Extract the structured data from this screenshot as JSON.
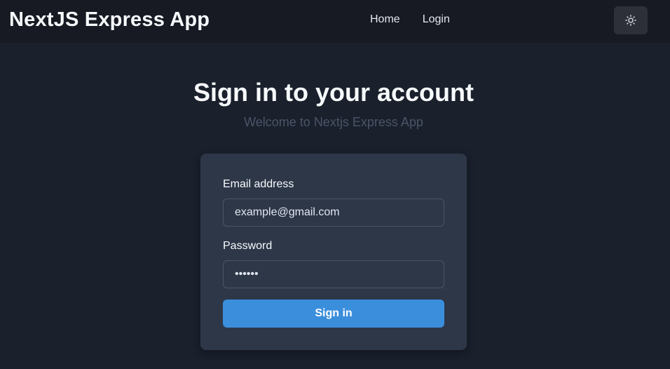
{
  "header": {
    "brand": "NextJS Express App",
    "nav": [
      {
        "label": "Home"
      },
      {
        "label": "Login"
      }
    ],
    "theme_toggle_icon": "sun-icon"
  },
  "main": {
    "title": "Sign in to your account",
    "subtitle": "Welcome to Nextjs Express App"
  },
  "form": {
    "email_label": "Email address",
    "email_value": "example@gmail.com",
    "password_label": "Password",
    "password_value": "123456",
    "submit_label": "Sign in"
  },
  "colors": {
    "background": "#1a202c",
    "navbar": "#171923",
    "card": "#2d3748",
    "accent": "#3b8edc"
  }
}
